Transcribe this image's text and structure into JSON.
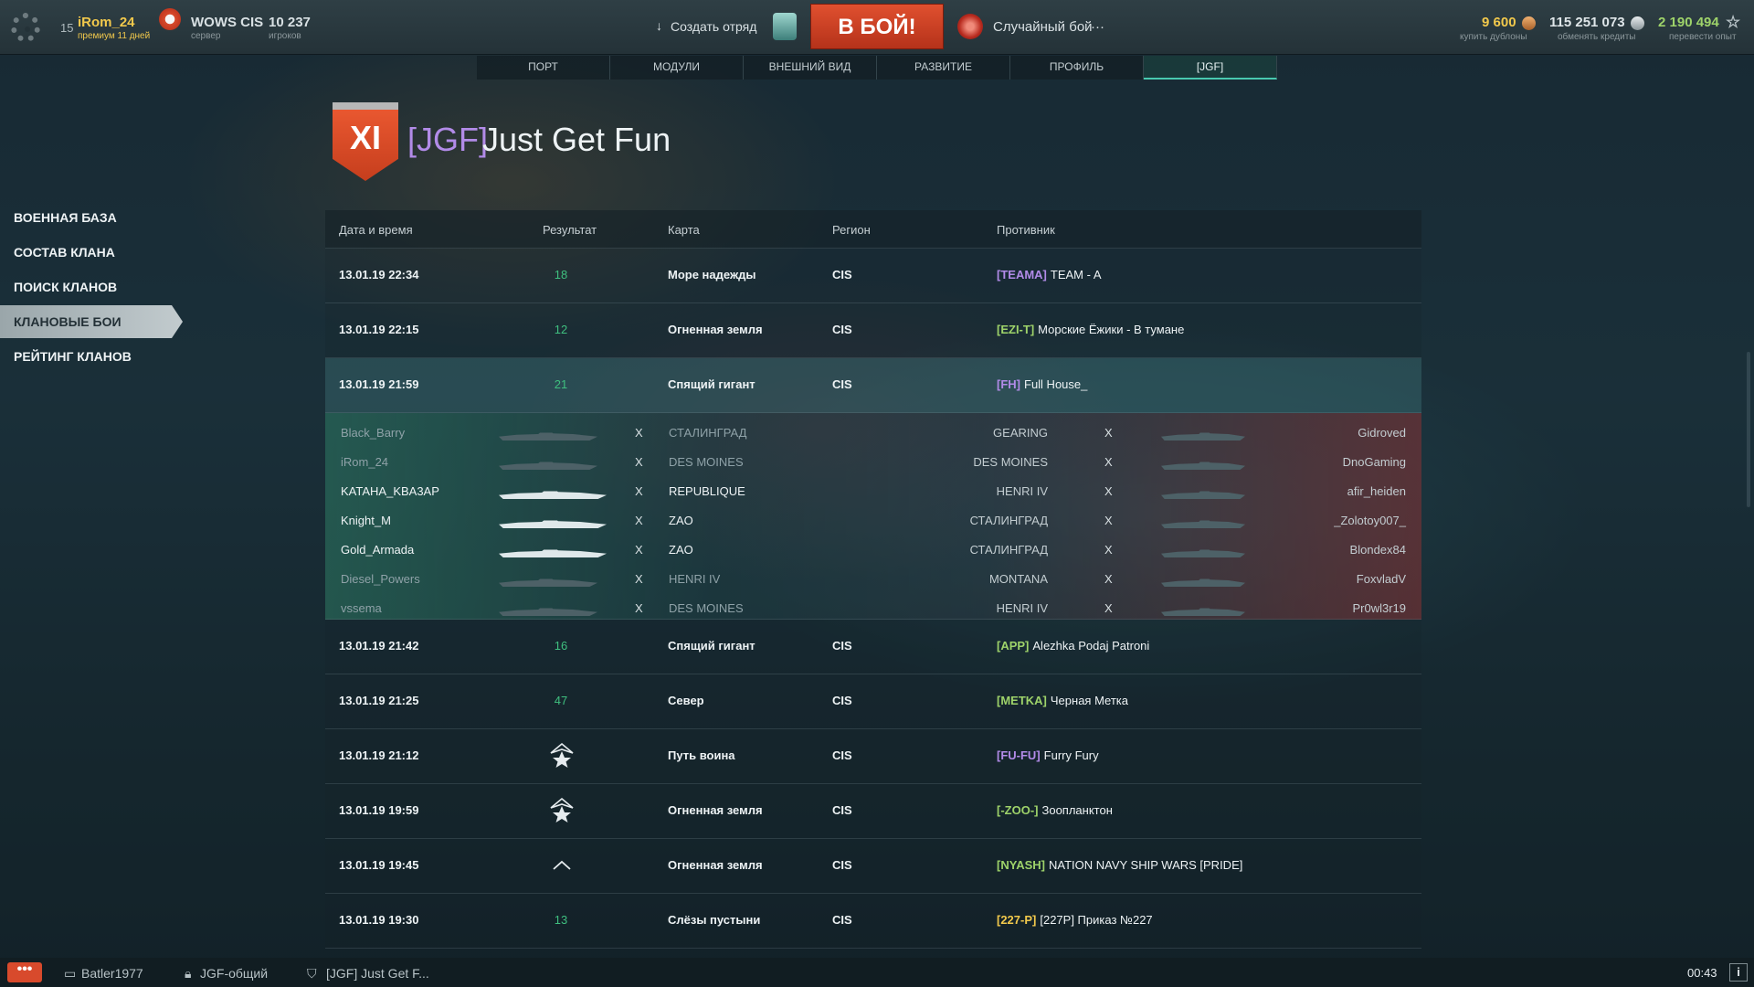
{
  "topbar": {
    "level": "15",
    "username": "iRom_24",
    "premium": "премиум 11 дней",
    "server": "WOWS CIS",
    "server_sub": "сервер",
    "players": "10 237",
    "players_sub": "игроков",
    "squad": "Создать отряд",
    "battle": "В БОЙ!",
    "mode": "Случайный бой",
    "mode_more": "···",
    "doubloons": "9 600",
    "doubloons_sub": "купить дублоны",
    "credits": "115 251 073",
    "credits_sub": "обменять кредиты",
    "xp": "2 190 494",
    "xp_sub": "перевести опыт",
    "colors": {
      "gold": "#f2c94c",
      "battle": "#d0442a",
      "xp": "#9ed36a"
    }
  },
  "tabs": [
    {
      "label": "ПОРТ"
    },
    {
      "label": "МОДУЛИ"
    },
    {
      "label": "ВНЕШНИЙ ВИД"
    },
    {
      "label": "РАЗВИТИЕ"
    },
    {
      "label": "ПРОФИЛЬ"
    },
    {
      "label": "[JGF]",
      "active": true
    }
  ],
  "clan": {
    "league": "XI",
    "tag": "[JGF]",
    "name": "Just Get Fun",
    "tag_color": "#b28be8"
  },
  "sidebar": [
    {
      "label": "ВОЕННАЯ БАЗА"
    },
    {
      "label": "СОСТАВ КЛАНА"
    },
    {
      "label": "ПОИСК КЛАНОВ"
    },
    {
      "label": "КЛАНОВЫЕ БОИ",
      "active": true
    },
    {
      "label": "РЕЙТИНГ КЛАНОВ"
    }
  ],
  "table": {
    "headers": [
      "Дата и время",
      "Результат",
      "Карта",
      "Регион",
      "Противник"
    ],
    "rows": [
      {
        "date": "13.01.19 22:34",
        "result": "18",
        "result_kind": "win",
        "map": "Море надежды",
        "region": "CIS",
        "opp_tag": "[TEAMA]",
        "opp_name": "TEAM - A",
        "tag_color": "#b28be8"
      },
      {
        "date": "13.01.19 22:15",
        "result": "12",
        "result_kind": "win",
        "map": "Огненная земля",
        "region": "CIS",
        "opp_tag": "[EZI-T]",
        "opp_name": "Морские Ёжики - В тумане",
        "tag_color": "#9ed36a"
      },
      {
        "date": "13.01.19 21:59",
        "result": "21",
        "result_kind": "win",
        "map": "Спящий гигант",
        "region": "CIS",
        "opp_tag": "[FH]",
        "opp_name": "Full House_",
        "tag_color": "#b28be8",
        "selected": true
      },
      {
        "date": "13.01.19 21:42",
        "result": "16",
        "result_kind": "win",
        "map": "Спящий гигант",
        "region": "CIS",
        "opp_tag": "[APP]",
        "opp_name": "Alezhka Podaj Patroni",
        "tag_color": "#9ed36a"
      },
      {
        "date": "13.01.19 21:25",
        "result": "47",
        "result_kind": "win",
        "map": "Север",
        "region": "CIS",
        "opp_tag": "[METKA]",
        "opp_name": "Черная Метка",
        "tag_color": "#9ed36a"
      },
      {
        "date": "13.01.19 21:12",
        "result": "",
        "result_kind": "star",
        "map": "Путь воина",
        "region": "CIS",
        "opp_tag": "[FU-FU]",
        "opp_name": "Furry Fury",
        "tag_color": "#b28be8"
      },
      {
        "date": "13.01.19 19:59",
        "result": "",
        "result_kind": "star",
        "map": "Огненная земля",
        "region": "CIS",
        "opp_tag": "[-ZOO-]",
        "opp_name": "Зоопланктон",
        "tag_color": "#9ed36a"
      },
      {
        "date": "13.01.19 19:45",
        "result": "",
        "result_kind": "chevron",
        "map": "Огненная земля",
        "region": "CIS",
        "opp_tag": "[NYASH]",
        "opp_name": "NATION NAVY SHIP WARS [PRIDE]",
        "tag_color": "#9ed36a"
      },
      {
        "date": "13.01.19 19:30",
        "result": "13",
        "result_kind": "win",
        "map": "Слёзы пустыни",
        "region": "CIS",
        "opp_tag": "[227-P]",
        "opp_name": "[227P] Приказ №227",
        "tag_color": "#f2c94c"
      }
    ],
    "expanded": {
      "separator": "X",
      "allies": [
        {
          "player": "Black_Barry",
          "ship": "СТАЛИНГРАД",
          "alive": false
        },
        {
          "player": "iRom_24",
          "ship": "DES MOINES",
          "alive": false
        },
        {
          "player": "KATAHA_KBA3AP",
          "ship": "REPUBLIQUE",
          "alive": true
        },
        {
          "player": "Knight_M",
          "ship": "ZAO",
          "alive": true
        },
        {
          "player": "Gold_Armada",
          "ship": "ZAO",
          "alive": true
        },
        {
          "player": "Diesel_Powers",
          "ship": "HENRI IV",
          "alive": false
        },
        {
          "player": "vssema",
          "ship": "DES MOINES",
          "alive": false
        }
      ],
      "enemies": [
        {
          "player": "Gidroved",
          "ship": "GEARING"
        },
        {
          "player": "DnoGaming",
          "ship": "DES MOINES"
        },
        {
          "player": "afir_heiden",
          "ship": "HENRI IV"
        },
        {
          "player": "_Zolotoy007_",
          "ship": "СТАЛИНГРАД"
        },
        {
          "player": "Blondex84",
          "ship": "СТАЛИНГРАД"
        },
        {
          "player": "FoxvladV",
          "ship": "MONTANA"
        },
        {
          "player": "Pr0wl3r19",
          "ship": "HENRI IV"
        }
      ]
    }
  },
  "bottombar": {
    "chat": "•••",
    "channels": [
      {
        "label": "Batler1977",
        "icon": "chat-icon"
      },
      {
        "label": "JGF-общий",
        "icon": "lock-icon"
      },
      {
        "label": "[JGF] Just Get F...",
        "icon": "shield-icon"
      }
    ],
    "time": "00:43",
    "info": "i"
  }
}
